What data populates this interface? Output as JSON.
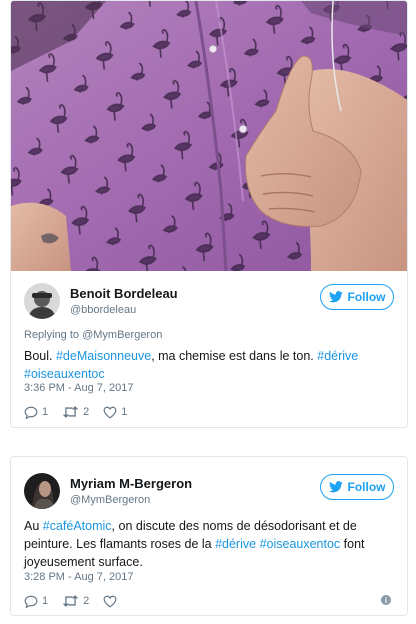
{
  "tweets": [
    {
      "display_name": "Benoit Bordeleau",
      "handle": "@bbordeleau",
      "follow_label": "Follow",
      "replying_to": "Replying to @MymBergeron",
      "text_parts": {
        "p1": "Boul. ",
        "tag1": "#deMaisonneuve",
        "p2": ", ma chemise est dans le ton. ",
        "tag2": "#dérive",
        "tag3": "#oiseauxentoc"
      },
      "timestamp": "3:36 PM - Aug 7, 2017",
      "reply_count": "1",
      "retweet_count": "2",
      "like_count": "1",
      "has_photo": true
    },
    {
      "display_name": "Myriam M-Bergeron",
      "handle": "@MymBergeron",
      "follow_label": "Follow",
      "text_parts": {
        "p1": "Au ",
        "tag1": "#caféAtomic",
        "p2": ", on discute des noms de désodorisant et de peinture. Les flamants roses de la ",
        "tag2": "#dérive",
        "tag3": "#oiseauxentoc",
        "p3": " font joyeusement surface."
      },
      "timestamp": "3:28 PM - Aug 7, 2017",
      "reply_count": "1",
      "retweet_count": "2",
      "like_count": ""
    }
  ],
  "colors": {
    "accent": "#1da1f2",
    "link": "#1b95e0",
    "muted": "#657786",
    "border": "#e1e8ed",
    "shirt": "#a26ab0"
  },
  "icons": [
    "reply-icon",
    "retweet-icon",
    "heart-icon",
    "info-icon",
    "twitter-bird-icon"
  ]
}
